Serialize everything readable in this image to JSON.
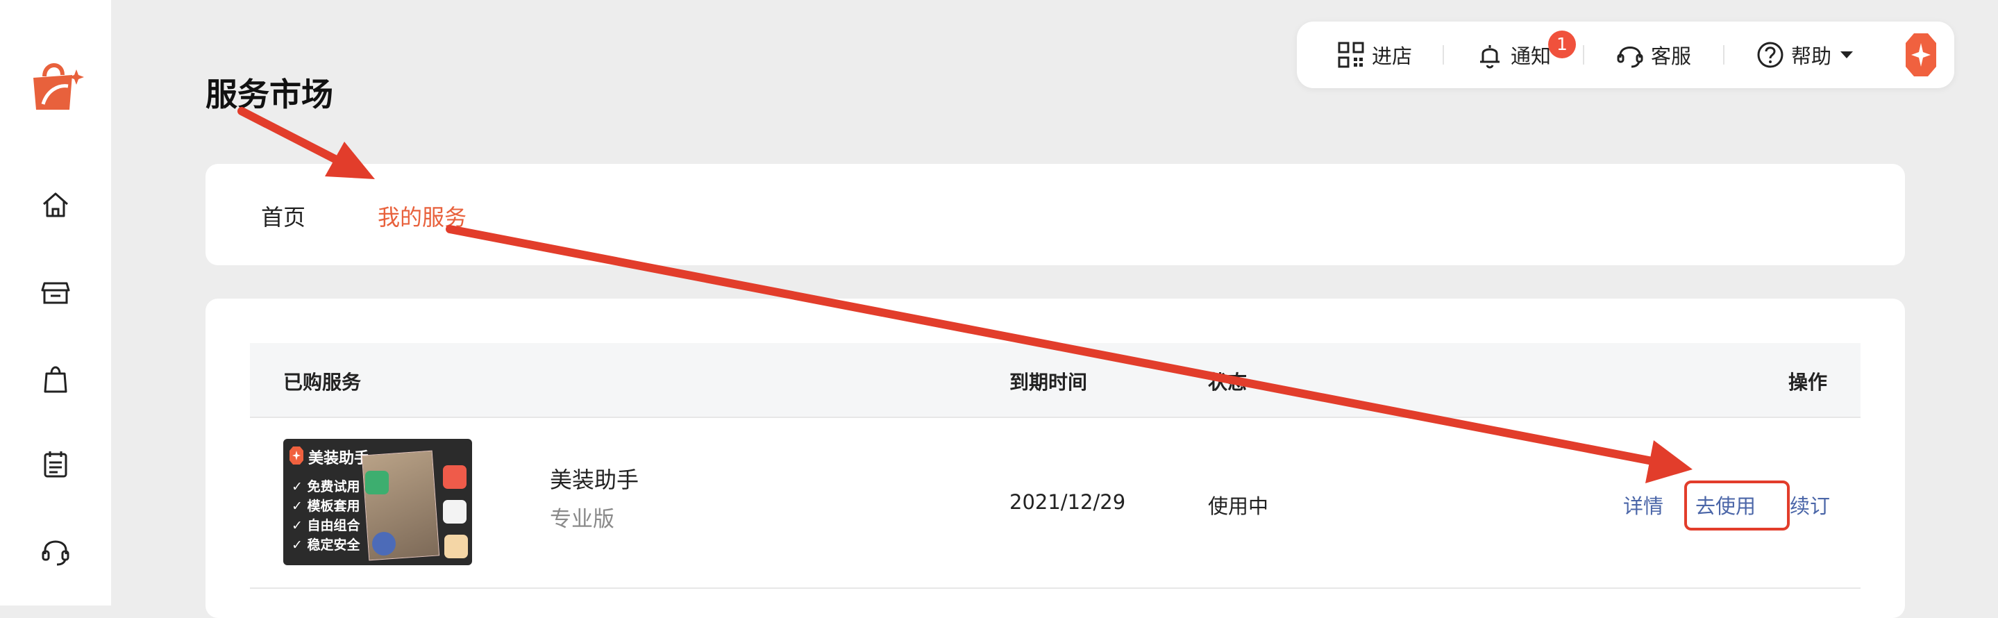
{
  "page": {
    "title": "服务市场"
  },
  "topbar": {
    "enter_shop": "进店",
    "notify": "通知",
    "notify_count": "1",
    "service": "客服",
    "help": "帮助"
  },
  "sidebar": {
    "items": [
      "home-icon",
      "store-icon",
      "bag-icon",
      "calendar-icon",
      "headset-icon"
    ]
  },
  "tabs": [
    {
      "label": "首页",
      "active": false
    },
    {
      "label": "我的服务",
      "active": true
    }
  ],
  "table": {
    "headers": {
      "service": "已购服务",
      "expire": "到期时间",
      "status": "状态",
      "actions": "操作"
    },
    "rows": [
      {
        "thumb": {
          "title": "美装助手",
          "features": [
            "免费试用",
            "模板套用",
            "自由组合",
            "稳定安全"
          ]
        },
        "name": "美装助手",
        "edition": "专业版",
        "expire": "2021/12/29",
        "status": "使用中",
        "actions": {
          "detail": "详情",
          "use": "去使用",
          "renew": "续订"
        }
      }
    ]
  },
  "colors": {
    "accent": "#e8613c",
    "link": "#4b66a8",
    "annotation_red": "#e23d2b",
    "badge": "#f0513c"
  }
}
